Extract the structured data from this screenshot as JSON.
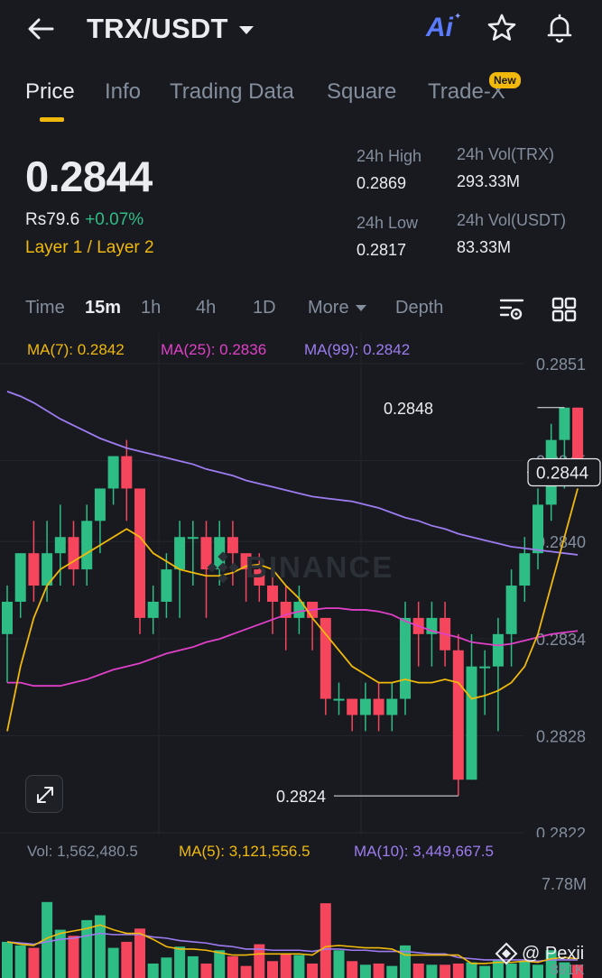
{
  "header": {
    "title": "TRX/USDT",
    "ai_label": "Ai"
  },
  "tabs": [
    {
      "label": "Price",
      "active": true
    },
    {
      "label": "Info"
    },
    {
      "label": "Trading Data"
    },
    {
      "label": "Square"
    },
    {
      "label": "Trade-X",
      "badge": "New"
    }
  ],
  "price": {
    "last": "0.2844",
    "fiat": "Rs79.6",
    "change": "+0.07%",
    "tag": "Layer 1 / Layer 2"
  },
  "stats": {
    "high_label": "24h High",
    "high": "0.2869",
    "low_label": "24h Low",
    "low": "0.2817",
    "vol_base_label": "24h Vol(TRX)",
    "vol_base": "293.33M",
    "vol_quote_label": "24h Vol(USDT)",
    "vol_quote": "83.33M"
  },
  "timebar": {
    "items": [
      "Time",
      "15m",
      "1h",
      "4h",
      "1D",
      "More",
      "Depth"
    ],
    "active": "15m"
  },
  "ma_legend": {
    "ma7": "MA(7): 0.2842",
    "ma25": "MA(25): 0.2836",
    "ma99": "MA(99): 0.2842"
  },
  "colors": {
    "up": "#2ebd85",
    "down": "#f6465d",
    "ma7": "#f0b90b",
    "ma25": "#e040c8",
    "ma99": "#9d7cf0",
    "accent": "#f0b90b"
  },
  "watermark": "BINANCE",
  "chart_data": {
    "type": "candlestick",
    "y_axis_labels": [
      "0.2851",
      "0.2845",
      "0.2840",
      "0.2834",
      "0.2828",
      "0.2822"
    ],
    "current_price_label": "0.2844",
    "high_marker": "0.2848",
    "low_marker": "0.2824",
    "ylim": [
      0.28215,
      0.28525
    ],
    "candles": [
      [
        0.2834,
        0.2836,
        0.2831,
        0.2837
      ],
      [
        0.2836,
        0.2839,
        0.2835,
        0.2839
      ],
      [
        0.2839,
        0.2837,
        0.2836,
        0.2841
      ],
      [
        0.2837,
        0.2839,
        0.2836,
        0.2841
      ],
      [
        0.2839,
        0.284,
        0.2837,
        0.2842
      ],
      [
        0.284,
        0.2838,
        0.2837,
        0.2841
      ],
      [
        0.2838,
        0.2841,
        0.2837,
        0.2842
      ],
      [
        0.2841,
        0.2843,
        0.2839,
        0.2843
      ],
      [
        0.2843,
        0.2845,
        0.2842,
        0.2845
      ],
      [
        0.2845,
        0.2843,
        0.2841,
        0.2846
      ],
      [
        0.2843,
        0.2835,
        0.2834,
        0.2843
      ],
      [
        0.2835,
        0.2836,
        0.2834,
        0.2837
      ],
      [
        0.2836,
        0.2838,
        0.2835,
        0.2839
      ],
      [
        0.2838,
        0.284,
        0.2835,
        0.2841
      ],
      [
        0.284,
        0.284,
        0.2837,
        0.2841
      ],
      [
        0.284,
        0.2838,
        0.2835,
        0.2841
      ],
      [
        0.2838,
        0.284,
        0.2837,
        0.2841
      ],
      [
        0.284,
        0.2839,
        0.2837,
        0.2841
      ],
      [
        0.2839,
        0.2838,
        0.2836,
        0.2838
      ],
      [
        0.2838,
        0.2837,
        0.2836,
        0.2839
      ],
      [
        0.2837,
        0.2836,
        0.2834,
        0.2838
      ],
      [
        0.2836,
        0.2835,
        0.2833,
        0.2837
      ],
      [
        0.2835,
        0.2836,
        0.2834,
        0.2837
      ],
      [
        0.2836,
        0.2835,
        0.2833,
        0.2836
      ],
      [
        0.2835,
        0.283,
        0.2829,
        0.2835
      ],
      [
        0.283,
        0.283,
        0.2829,
        0.2831
      ],
      [
        0.283,
        0.2829,
        0.2828,
        0.283
      ],
      [
        0.2829,
        0.283,
        0.2828,
        0.2831
      ],
      [
        0.283,
        0.2829,
        0.2828,
        0.2831
      ],
      [
        0.2829,
        0.283,
        0.2828,
        0.2831
      ],
      [
        0.283,
        0.2835,
        0.2829,
        0.2836
      ],
      [
        0.2835,
        0.2834,
        0.2832,
        0.2836
      ],
      [
        0.2834,
        0.2835,
        0.2832,
        0.2836
      ],
      [
        0.2835,
        0.2833,
        0.2832,
        0.2836
      ],
      [
        0.2833,
        0.2825,
        0.2824,
        0.2834
      ],
      [
        0.2825,
        0.2832,
        0.2825,
        0.2834
      ],
      [
        0.2832,
        0.2832,
        0.2829,
        0.2833
      ],
      [
        0.2832,
        0.2834,
        0.2828,
        0.2835
      ],
      [
        0.2834,
        0.2837,
        0.2832,
        0.2838
      ],
      [
        0.2837,
        0.2839,
        0.2836,
        0.284
      ],
      [
        0.2839,
        0.2842,
        0.2838,
        0.2843
      ],
      [
        0.2842,
        0.2846,
        0.2841,
        0.2847
      ],
      [
        0.2846,
        0.2848,
        0.2843,
        0.2848
      ],
      [
        0.2848,
        0.2844,
        0.2844,
        0.2848
      ]
    ],
    "ma7": [
      0.2828,
      0.2832,
      0.2835,
      0.2837,
      0.2838,
      0.28385,
      0.2839,
      0.28395,
      0.284,
      0.28405,
      0.284,
      0.2839,
      0.28385,
      0.2838,
      0.28378,
      0.28376,
      0.28376,
      0.28378,
      0.28382,
      0.28383,
      0.2838,
      0.2837,
      0.28362,
      0.2835,
      0.2834,
      0.2833,
      0.2832,
      0.28315,
      0.2831,
      0.2831,
      0.28312,
      0.2831,
      0.2831,
      0.28312,
      0.2831,
      0.283,
      0.28302,
      0.28305,
      0.2831,
      0.2832,
      0.2834,
      0.2837,
      0.284,
      0.2843
    ],
    "ma25": [
      0.2831,
      0.2831,
      0.28308,
      0.28308,
      0.28308,
      0.2831,
      0.28312,
      0.28315,
      0.28318,
      0.2832,
      0.28322,
      0.28325,
      0.28328,
      0.2833,
      0.28332,
      0.28335,
      0.28337,
      0.2834,
      0.28343,
      0.28346,
      0.28349,
      0.28352,
      0.28354,
      0.28355,
      0.28356,
      0.28356,
      0.28355,
      0.28355,
      0.28354,
      0.28352,
      0.28348,
      0.28345,
      0.28342,
      0.2834,
      0.28338,
      0.28335,
      0.28334,
      0.28333,
      0.28334,
      0.28336,
      0.28338,
      0.2834,
      0.28341,
      0.28342
    ],
    "ma99": [
      0.2849,
      0.28487,
      0.28483,
      0.28478,
      0.28473,
      0.28469,
      0.28465,
      0.28461,
      0.28458,
      0.28455,
      0.28453,
      0.28451,
      0.28449,
      0.28447,
      0.28445,
      0.28442,
      0.2844,
      0.28438,
      0.28435,
      0.28433,
      0.28431,
      0.28429,
      0.28427,
      0.28425,
      0.28424,
      0.28423,
      0.28422,
      0.2842,
      0.28418,
      0.28415,
      0.28412,
      0.2841,
      0.28407,
      0.28405,
      0.28402,
      0.284,
      0.28398,
      0.28396,
      0.28394,
      0.28393,
      0.28392,
      0.28391,
      0.2839,
      0.28389
    ]
  },
  "volume": {
    "vol_label": "Vol: 1,562,480.5",
    "ma5_label": "MA(5): 3,121,556.5",
    "ma10_label": "MA(10): 3,449,667.5",
    "axis_top": "7.78M",
    "axis_bottom": "891K",
    "values": [
      3.0,
      2.7,
      2.5,
      6.3,
      4.0,
      3.5,
      4.8,
      5.2,
      2.5,
      3.0,
      4.1,
      1.2,
      1.7,
      2.6,
      1.8,
      1.2,
      2.3,
      1.8,
      1.0,
      2.8,
      1.4,
      2.0,
      1.9,
      1.2,
      6.2,
      2.3,
      1.4,
      1.1,
      1.2,
      1.0,
      2.7,
      1.2,
      1.1,
      1.1,
      1.2,
      1.3,
      1.0,
      1.5,
      1.2,
      1.4,
      1.1,
      2.3,
      1.3,
      1.1
    ],
    "ma5": [
      3.0,
      2.8,
      2.7,
      3.3,
      3.7,
      3.9,
      4.1,
      4.4,
      4.0,
      3.7,
      3.7,
      3.2,
      2.6,
      2.4,
      2.4,
      2.3,
      2.1,
      1.9,
      1.9,
      2.0,
      2.0,
      2.0,
      2.0,
      1.9,
      2.6,
      2.7,
      2.6,
      2.5,
      2.5,
      2.4,
      1.9,
      1.9,
      1.9,
      1.9,
      1.9,
      1.2,
      1.2,
      1.3,
      1.3,
      1.4,
      1.3,
      1.6,
      1.7,
      1.6
    ],
    "ma10": [
      3.0,
      2.9,
      2.8,
      3.0,
      3.2,
      3.3,
      3.5,
      3.7,
      3.6,
      3.6,
      3.6,
      3.4,
      3.3,
      3.1,
      3.0,
      2.9,
      2.7,
      2.6,
      2.4,
      2.4,
      2.3,
      2.3,
      2.3,
      2.2,
      2.4,
      2.4,
      2.3,
      2.3,
      2.2,
      2.2,
      2.2,
      2.1,
      2.0,
      2.0,
      1.7,
      1.6,
      1.5,
      1.5,
      1.5,
      1.5,
      1.4,
      1.5,
      1.5,
      1.5
    ]
  },
  "credit": "@ Pexii"
}
